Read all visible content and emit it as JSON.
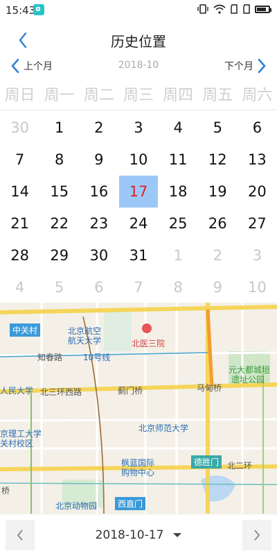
{
  "status": {
    "time": "15:43"
  },
  "header": {
    "title": "历史位置"
  },
  "month_nav": {
    "prev_label": "上个月",
    "current": "2018-10",
    "next_label": "下个月"
  },
  "weekdays": [
    "周日",
    "周一",
    "周二",
    "周三",
    "周四",
    "周五",
    "周六"
  ],
  "days": [
    {
      "label": "30",
      "other": true
    },
    {
      "label": "1"
    },
    {
      "label": "2"
    },
    {
      "label": "3"
    },
    {
      "label": "4"
    },
    {
      "label": "5"
    },
    {
      "label": "6"
    },
    {
      "label": "7"
    },
    {
      "label": "8"
    },
    {
      "label": "9"
    },
    {
      "label": "10"
    },
    {
      "label": "11"
    },
    {
      "label": "12"
    },
    {
      "label": "13"
    },
    {
      "label": "14"
    },
    {
      "label": "15"
    },
    {
      "label": "16"
    },
    {
      "label": "17",
      "selected": true
    },
    {
      "label": "18"
    },
    {
      "label": "19"
    },
    {
      "label": "20"
    },
    {
      "label": "21"
    },
    {
      "label": "22"
    },
    {
      "label": "23"
    },
    {
      "label": "24"
    },
    {
      "label": "25"
    },
    {
      "label": "26"
    },
    {
      "label": "27"
    },
    {
      "label": "28"
    },
    {
      "label": "29"
    },
    {
      "label": "30"
    },
    {
      "label": "31"
    },
    {
      "label": "1",
      "other": true
    },
    {
      "label": "2",
      "other": true
    },
    {
      "label": "3",
      "other": true
    },
    {
      "label": "4",
      "other": true
    },
    {
      "label": "5",
      "other": true
    },
    {
      "label": "6",
      "other": true
    },
    {
      "label": "7",
      "other": true
    },
    {
      "label": "8",
      "other": true
    },
    {
      "label": "9",
      "other": true
    },
    {
      "label": "10",
      "other": true
    }
  ],
  "map": {
    "labels": {
      "zhongguancun": "中关村",
      "beihang": "北京航空",
      "beihang2": "航天大学",
      "beiyisanyuan": "北医三院",
      "zhichunlu": "知春路",
      "line10": "10号线",
      "yuandadu": "元大都城垣",
      "yuandadu2": "遗址公园",
      "renda": "人民大学",
      "beisanhuan": "北三环西路",
      "jimenqiao": "蓟门桥",
      "madianqiao": "马甸桥",
      "ligong": "京理工大学",
      "ligong2": "关村校区",
      "beishida": "北京师范大学",
      "fenglan": "枫蓝国际",
      "fenglan2": "购物中心",
      "deshengmen": "德胜门",
      "beierhuan": "北二环",
      "dongwuyuan": "北京动物园",
      "xizhimen": "西直门",
      "qiao": "桥"
    }
  },
  "bottom": {
    "selected_date": "2018-10-17"
  },
  "colors": {
    "accent": "#2f80d8",
    "selected_bg": "#9cc8f7",
    "selected_text": "#e02020"
  }
}
